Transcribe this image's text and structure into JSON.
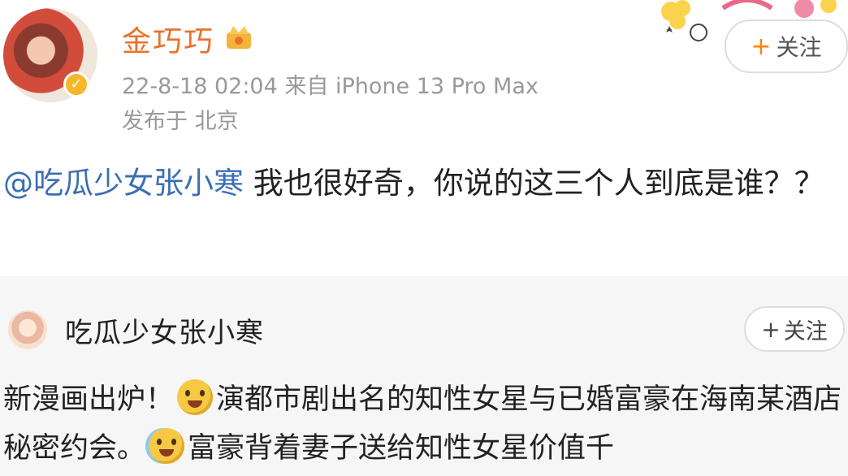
{
  "post": {
    "author": "金巧巧",
    "timestamp": "22-8-18 02:04",
    "source": "来自 iPhone 13 Pro Max",
    "location": "发布于 北京",
    "follow_label": "关注",
    "follow_plus": "+",
    "mention": "@吃瓜少女张小寒",
    "text": " 我也很好奇，你说的这三个人到底是谁？？"
  },
  "repost": {
    "author": "吃瓜少女张小寒",
    "follow_label": "关注",
    "follow_plus": "+",
    "text_part1": "新漫画出炉！",
    "text_part2": "演都市剧出名的知性女星与已婚富豪在海南某酒店秘密约会。",
    "text_part3": "富豪背着妻子送给知性女星价值千"
  },
  "icons": {
    "verified": "verified-badge-icon",
    "crown": "crown-member-icon",
    "emoji1": "laughing-emoji-icon",
    "emoji2": "sweating-emoji-icon"
  },
  "colors": {
    "author_name": "#e8722a",
    "mention": "#3b6fb3",
    "follow_plus": "#ff8200",
    "meta": "#999999"
  }
}
